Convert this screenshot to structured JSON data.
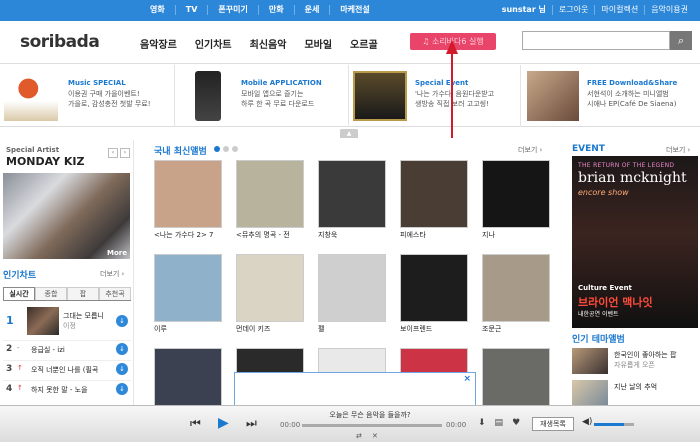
{
  "topbar": {
    "menu": [
      "영화",
      "TV",
      "폰꾸미기",
      "만화",
      "운세",
      "마케전설"
    ],
    "user": [
      "sunstar 님",
      "로그아웃",
      "마이컬렉션",
      "음악이용권"
    ]
  },
  "header": {
    "logo": "soribada",
    "nav": [
      "음악장르",
      "인기차트",
      "최신음악",
      "모바일",
      "오르골"
    ],
    "run_button": "소리바다6 실행",
    "search_placeholder": ""
  },
  "banners": [
    {
      "title": "Music SPECIAL",
      "desc": "이용권 구매 가을이벤트!\n가을로, 감성충전 첫발 무료!"
    },
    {
      "title": "Mobile APPLICATION",
      "desc": "모바일 앱으로 즐기는\n하루 한 곡 무료 다운로드"
    },
    {
      "title": "Special Event",
      "desc": "'나는 가수다' 음원다운받고\n생방송 직접 보러 고고씽!"
    },
    {
      "title": "FREE Download&Share",
      "desc": "서현석이 소개하는 미니앨범\n시애나 EP(Café De Siaena)"
    }
  ],
  "left": {
    "special_label": "Special Artist",
    "artist": "MONDAY KIZ",
    "more": "More",
    "chart_title": "인기차트",
    "more_link": "더보기 ›",
    "tabs": [
      "실시간",
      "종합",
      "팝",
      "추천곡"
    ],
    "rank1": {
      "num": "1",
      "title": "그대는 모릅니",
      "artist": "이정"
    },
    "rows": [
      {
        "n": "2",
        "mark": "-",
        "title": "응급실 - izi"
      },
      {
        "n": "3",
        "mark": "↑",
        "title": "오직 너뿐인 나를 (필곡"
      },
      {
        "n": "4",
        "mark": "↑",
        "title": "하지 못한 말 - 노을"
      }
    ]
  },
  "center": {
    "title": "국내 최신앨범",
    "more_link": "더보기 ›",
    "albums": [
      {
        "label": "<나는 가수다 2> 7",
        "color": "#c9a28a"
      },
      {
        "label": "<뮤추의 명곡 - 전",
        "color": "#b8b39c"
      },
      {
        "label": "지창욱",
        "color": "#3a3a3a"
      },
      {
        "label": "피에스타",
        "color": "#4a3e34"
      },
      {
        "label": "지나",
        "color": "#151515"
      },
      {
        "label": "이루",
        "color": "#8fb1c9"
      },
      {
        "label": "먼데이 키즈",
        "color": "#d9d4c4"
      },
      {
        "label": "펠",
        "color": "#cfcfcf"
      },
      {
        "label": "보이프렌드",
        "color": "#1d1d1d"
      },
      {
        "label": "조문근",
        "color": "#a89a88"
      },
      {
        "label": "",
        "color": "#3b4150"
      },
      {
        "label": "",
        "color": "#2a2a2a"
      },
      {
        "label": "",
        "color": "#e9e9e9"
      },
      {
        "label": "",
        "color": "#cc3344"
      },
      {
        "label": "",
        "color": "#6a6a66"
      }
    ]
  },
  "right": {
    "event_title": "EVENT",
    "more_link": "더보기 ›",
    "event_small": "THE RETURN OF THE LEGEND",
    "event_name": "brian mcknight",
    "event_encore": "encore show",
    "culture": "Culture Event",
    "korean_name": "브라이언 맥나잇",
    "korean_sub": "내한공연 이벤트",
    "theme_title": "인기 테마앨범",
    "themes": [
      {
        "title": "한국인이 좋아하는 팝",
        "sub": "자유롭게 오픈"
      },
      {
        "title": "지난 날의 추억",
        "sub": ""
      }
    ]
  },
  "player": {
    "title": "오늘은 무슨 음악을 들을까?",
    "time_start": "00:00",
    "time_end": "00:00",
    "playlist": "재생목록"
  },
  "colors": {
    "accent": "#1b78cf",
    "topbar": "#2d87d8",
    "run": "#e9446a"
  }
}
